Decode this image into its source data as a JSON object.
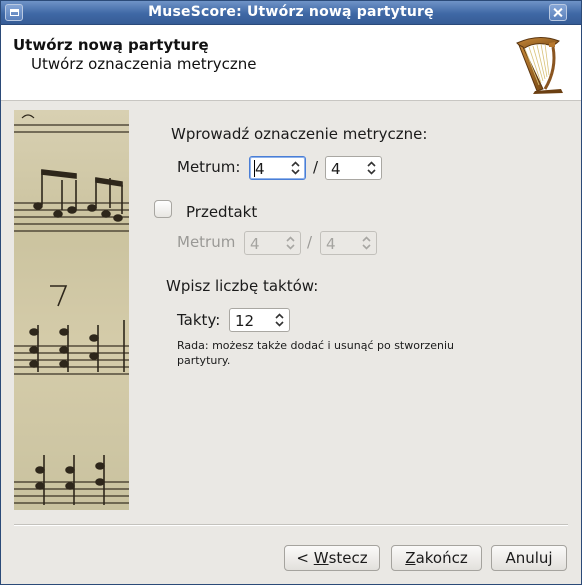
{
  "window": {
    "title": "MuseScore: Utwórz nową partyturę"
  },
  "header": {
    "title": "Utwórz nową partyturę",
    "subtitle": "Utwórz oznaczenia metryczne"
  },
  "form": {
    "time_signature_heading": "Wprowadź oznaczenie metryczne:",
    "meter_label": "Metrum:",
    "meter_numerator": "4",
    "meter_separator": "/",
    "meter_denominator": "4",
    "pickup_label": "Przedtakt",
    "pickup_checked": false,
    "pickup_meter_label": "Metrum",
    "pickup_numerator": "4",
    "pickup_separator": "/",
    "pickup_denominator": "4",
    "measures_heading": "Wpisz liczbę taktów:",
    "measures_label": "Takty:",
    "measures_value": "12",
    "hint": "Rada: możesz także dodać i usunąć po stworzeniu partytury."
  },
  "buttons": {
    "back": {
      "prefix": "< ",
      "mnemonic": "W",
      "rest": "stecz"
    },
    "finish": {
      "mnemonic": "Z",
      "rest": "akończ"
    },
    "cancel": "Anuluj"
  },
  "colors": {
    "titlebar": "#3f68a5",
    "focus_border": "#4a7ed6",
    "banner_paper": "#cbc39f"
  },
  "icons": {
    "window_menu": "window-menu-icon",
    "close": "close-icon",
    "logo": "harp-logo-icon",
    "spin": "spin-arrows-icon"
  }
}
